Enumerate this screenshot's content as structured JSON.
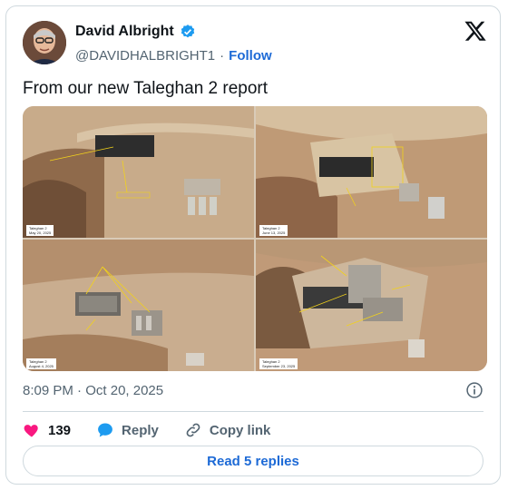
{
  "author": {
    "name": "David Albright",
    "handle": "@DAVIDHALBRIGHT1",
    "separator": "·",
    "follow_label": "Follow"
  },
  "tweet": {
    "text": "From our new Taleghan 2 report"
  },
  "media": {
    "panels": [
      {
        "caption": "Taleghan 2\nMay 20, 2025"
      },
      {
        "caption": "Taleghan 2\nJune 13, 2025"
      },
      {
        "caption": "Taleghan 2\nAugust 4, 2025"
      },
      {
        "caption": "Taleghan 2\nSeptember 23, 2025"
      }
    ]
  },
  "meta": {
    "time": "8:09 PM",
    "dot": "·",
    "date": "Oct 20, 2025"
  },
  "actions": {
    "like_count": "139",
    "reply_label": "Reply",
    "copy_link_label": "Copy link"
  },
  "read_replies_label": "Read 5 replies",
  "colors": {
    "accent": "#1d6ad6",
    "like": "#f91880",
    "muted": "#536471"
  }
}
